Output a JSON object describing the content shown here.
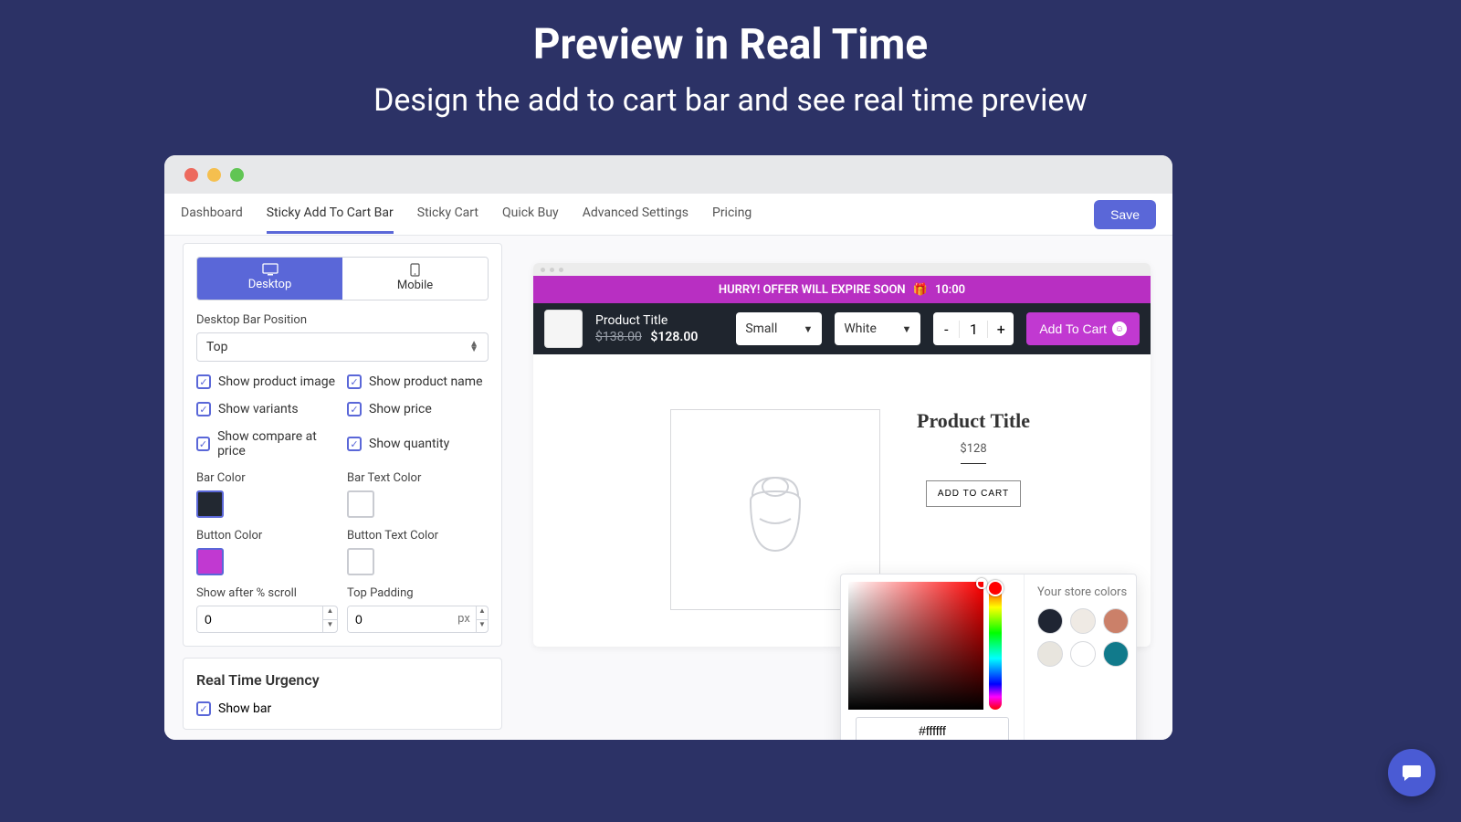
{
  "hero": {
    "title": "Preview in Real Time",
    "subtitle": "Design the add to cart bar and see real time preview"
  },
  "appbar": {
    "tabs": {
      "dashboard": "Dashboard",
      "sticky_atc": "Sticky Add To Cart Bar",
      "sticky_cart": "Sticky Cart",
      "quick_buy": "Quick Buy",
      "advanced": "Advanced Settings",
      "pricing": "Pricing"
    },
    "save": "Save"
  },
  "settings": {
    "device_tabs": {
      "desktop": "Desktop",
      "mobile": "Mobile"
    },
    "bar_position_label": "Desktop Bar Position",
    "bar_position_value": "Top",
    "checks": {
      "show_image": "Show product image",
      "show_name": "Show product name",
      "show_variants": "Show variants",
      "show_price": "Show price",
      "show_compare": "Show compare at price",
      "show_qty": "Show quantity"
    },
    "colors": {
      "bar_label": "Bar Color",
      "bar_value": "#222831",
      "bar_text_label": "Bar Text Color",
      "bar_text_value": "#ffffff",
      "button_label": "Button Color",
      "button_value": "#c139d1",
      "button_text_label": "Button Text Color",
      "button_text_value": "#ffffff"
    },
    "scroll": {
      "label": "Show after % scroll",
      "value": "0"
    },
    "padding": {
      "label": "Top Padding",
      "value": "0",
      "unit": "px"
    },
    "urgency": {
      "title": "Real Time Urgency",
      "show_bar": "Show bar"
    }
  },
  "preview": {
    "expire": {
      "text": "HURRY! OFFER WILL EXPIRE SOON",
      "time": "10:00"
    },
    "bar": {
      "title": "Product Title",
      "old_price": "$138.00",
      "price": "$128.00",
      "variant1": "Small",
      "variant2": "White",
      "qty": "1",
      "atc": "Add To Cart"
    },
    "page": {
      "title": "Product Title",
      "price": "$128",
      "atc": "ADD TO CART"
    }
  },
  "picker": {
    "hex": "#ffffff",
    "store_label": "Your store colors",
    "swatches": [
      "#1f2533",
      "#efeae4",
      "#cb8069",
      "#e8e5de",
      "#ffffff",
      "#117a8b"
    ]
  }
}
